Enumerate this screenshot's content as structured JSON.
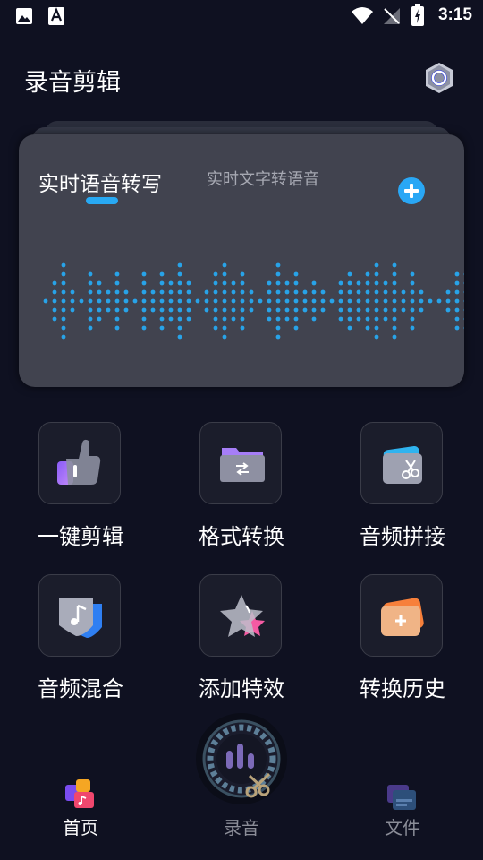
{
  "status_bar": {
    "time": "3:15"
  },
  "header": {
    "title": "录音剪辑"
  },
  "card": {
    "tabs": [
      {
        "label": "实时语音转写",
        "active": true
      },
      {
        "label": "实时文字转语音",
        "active": false
      }
    ]
  },
  "features": [
    {
      "label": "一键剪辑",
      "icon": "thumbs-up-icon"
    },
    {
      "label": "格式转换",
      "icon": "folder-convert-icon"
    },
    {
      "label": "音频拼接",
      "icon": "scissors-card-icon"
    },
    {
      "label": "音频混合",
      "icon": "music-shield-icon"
    },
    {
      "label": "添加特效",
      "icon": "star-icon"
    },
    {
      "label": "转换历史",
      "icon": "history-card-icon"
    }
  ],
  "bottom_nav": {
    "items": [
      {
        "label": "首页",
        "active": true
      },
      {
        "label": "录音",
        "active": false
      },
      {
        "label": "文件",
        "active": false
      }
    ]
  },
  "colors": {
    "background": "#0f1121",
    "accent": "#28a9f3",
    "card": "#41434f"
  }
}
